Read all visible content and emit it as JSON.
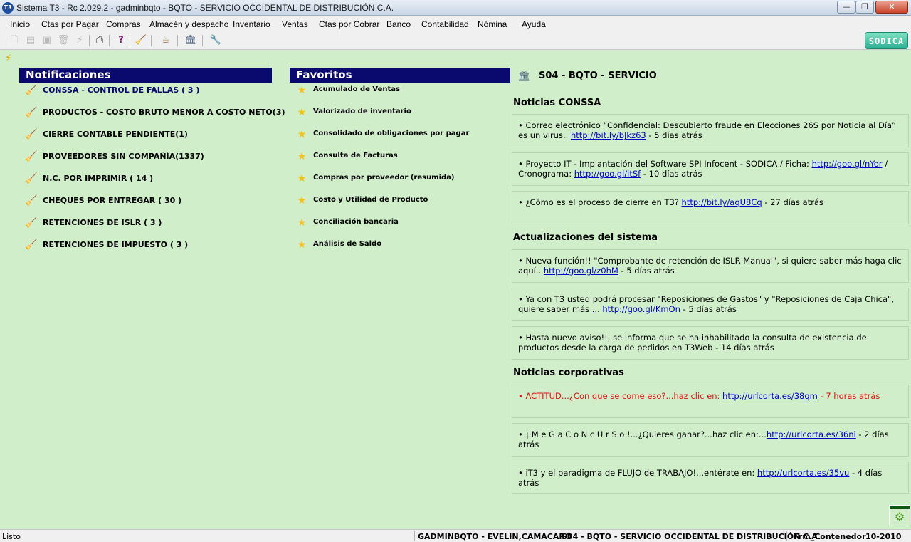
{
  "window": {
    "title": "Sistema T3 - Rc 2.029.2 - gadminbqto - BQTO - SERVICIO OCCIDENTAL DE DISTRIBUCIÓN C.A.",
    "app_icon": "T3",
    "minimize": "—",
    "maximize": "❐",
    "close": "✕"
  },
  "menu": [
    "Inicio",
    "Ctas por Pagar",
    "Compras",
    "Almacén y despacho",
    "Inventario",
    "Ventas",
    "Ctas por Cobrar",
    "Banco",
    "Contabilidad",
    "Nómina",
    "Ayuda"
  ],
  "toolbar": {
    "icons": [
      "new-document-icon",
      "open-icon",
      "save-icon",
      "delete-icon",
      "flash-icon",
      "print-icon",
      "help-icon",
      "broom-icon",
      "coffee-icon",
      "bank-icon",
      "tools-icon"
    ],
    "logo": "SODICA"
  },
  "notifications": {
    "title": "Notificaciones",
    "items": [
      "CONSSA - CONTROL DE FALLAS ( 3 )",
      "PRODUCTOS - COSTO BRUTO MENOR A COSTO NETO(3)",
      "CIERRE CONTABLE PENDIENTE(1)",
      "PROVEEDORES SIN COMPAÑÍA(1337)",
      "N.C. POR IMPRIMIR  ( 14 )",
      "CHEQUES POR ENTREGAR  ( 30 )",
      "RETENCIONES DE ISLR  ( 3 )",
      "RETENCIONES DE IMPUESTO  ( 3 )"
    ]
  },
  "favorites": {
    "title": "Favoritos",
    "items": [
      "Acumulado de Ventas",
      "Valorizado de inventario",
      "Consolidado de obligaciones por pagar",
      "Consulta de Facturas",
      "Compras por proveedor (resumida)",
      "Costo y Utilidad de Producto",
      "Conciliación bancaria",
      "Análisis de Saldo"
    ]
  },
  "company": "S04 - BQTO - SERVICIO",
  "sections": {
    "conssa": {
      "title": "Noticias CONSSA",
      "items": [
        {
          "text": "• Correo electrónico “Confidencial: Descubierto fraude en Elecciones 26S por Noticia al Día” es un virus.. ",
          "link": "http://bit.ly/bJkz63",
          "suffix": " - 5 días atrás"
        },
        {
          "text": "• Proyecto IT - Implantación del Software SPI Infocent - SODICA / Ficha: ",
          "link": "http://goo.gl/nYor",
          "mid": " / Cronograma: ",
          "link2": "http://goo.gl/itSf",
          "suffix": " - 10 días atrás"
        },
        {
          "text": "• ¿Cómo es el proceso de cierre en T3? ",
          "link": "http://bit.ly/aqU8Cq",
          "suffix": " - 27 días atrás"
        }
      ]
    },
    "updates": {
      "title": "Actualizaciones del sistema",
      "items": [
        {
          "text": "• Nueva función!! \"Comprobante de retención de ISLR Manual\", si quiere saber más haga clic aquí.. ",
          "link": "http://goo.gl/z0hM",
          "suffix": " - 5 días atrás"
        },
        {
          "text": "• Ya con T3 usted podrá procesar \"Reposiciones de Gastos\" y \"Reposiciones de Caja Chica\", quiere saber más ... ",
          "link": "http://goo.gl/KmOn",
          "suffix": " - 5 días atrás"
        },
        {
          "text": "• Hasta nuevo aviso!!, se informa que se ha inhabilitado la consulta de existencia de productos desde la carga de pedidos en T3Web - 14 días atrás"
        }
      ]
    },
    "corporate": {
      "title": "Noticias corporativas",
      "items": [
        {
          "text": "• ACTITUD...¿Con que se come eso?...haz clic en: ",
          "link": "http://urlcorta.es/38qm",
          "suffix": " - 7 horas atrás"
        },
        {
          "text": "• ¡ M e G a C o N c U r S o !...¿Quieres ganar?...haz clic en:...",
          "link": "http://urlcorta.es/36ni",
          "suffix": " - 2 días atrás"
        },
        {
          "text": "• iT3 y el paradigma de FLUJO de TRABAJO!...entérate en: ",
          "link": "http://urlcorta.es/35vu",
          "suffix": " - 4 días atrás"
        }
      ]
    }
  },
  "status": {
    "ready": "Listo",
    "user": "GADMINBQTO - EVELIN,CAMACARO",
    "company": "S04 - BQTO - SERVICIO OCCIDENTAL DE DISTRIBUCIÓN C.A.",
    "form": "Frm_Contenedor",
    "period": "10-2010"
  },
  "colors": {
    "background": "#cfeec9",
    "header": "#0a0a6e",
    "link": "#0000cc",
    "alert": "#e01010"
  }
}
